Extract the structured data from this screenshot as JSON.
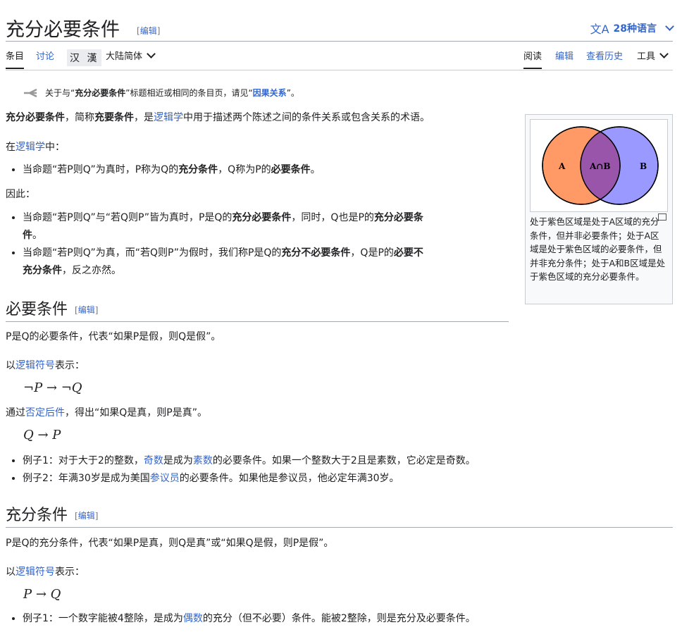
{
  "title": "充分必要条件",
  "edit_label": "编辑",
  "lang_button": {
    "icon": "文A",
    "label": "28种语言"
  },
  "tabs": {
    "article": "条目",
    "talk": "讨论",
    "variant_toggle": "汉 漢",
    "variant_select": "大陆简体",
    "read": "阅读",
    "edit": "编辑",
    "history": "查看历史",
    "tools": "工具"
  },
  "hatnote": {
    "pre": "关于与“",
    "bold": "充分必要条件",
    "mid": "”标题相近或相同的条目页，请见“",
    "link": "因果关系",
    "post": "”。"
  },
  "intro": {
    "b1": "充分必要条件",
    "t1": "，简称",
    "b2": "充要条件",
    "t2": "，是",
    "link": "逻辑学",
    "t3": "中用于描述两个陈述之间的条件关系或包含关系的术语。"
  },
  "in_logic": {
    "pre": "在",
    "link": "逻辑学",
    "post": "中："
  },
  "bullet1": {
    "t1": "当命题“若P则Q”为真时，P称为Q的",
    "b1": "充分条件",
    "t2": "，Q称为P的",
    "b2": "必要条件",
    "t3": "。"
  },
  "therefore": "因此：",
  "bullet2": {
    "t1": "当命题“若P则Q”与“若Q则P”皆为真时，P是Q的",
    "b1": "充分必要条件",
    "t2": "，同时，Q也是P的",
    "b2": "充分必要条",
    "b3": "件",
    "t3": "。"
  },
  "bullet3": {
    "t1": "当命题“若P则Q”为真，而“若Q则P”为假时，我们称P是Q的",
    "b1": "充分不必要条件",
    "t2": "，Q是P的",
    "b2": "必要不",
    "b3": "充分条件",
    "t3": "，反之亦然。"
  },
  "necessary": {
    "heading": "必要条件",
    "def": "P是Q的必要条件，代表“如果P是假，则Q是假”。",
    "sym": {
      "pre": "以",
      "link": "逻辑符号",
      "post": "表示："
    },
    "math1": "¬P → ¬Q",
    "contra": {
      "pre": "通过",
      "link": "否定后件",
      "post": "，得出“如果Q是真，则P是真”。"
    },
    "math2": "Q → P",
    "ex1": {
      "t1": "例子1：对于大于2的整数，",
      "l1": "奇数",
      "t2": "是成为",
      "l2": "素数",
      "t3": "的必要条件。如果一个整数大于2且是素数，它必定是奇数。"
    },
    "ex2": {
      "t1": "例子2：年满30岁是成为美国",
      "l1": "参议员",
      "t2": "的必要条件。如果他是参议员，他必定年满30岁。"
    }
  },
  "sufficient": {
    "heading": "充分条件",
    "def": "P是Q的充分条件，代表“如果P是真，则Q是真”或“如果Q是假，则P是假”。",
    "sym": {
      "pre": "以",
      "link": "逻辑符号",
      "post": "表示："
    },
    "math1": "P → Q",
    "ex1": {
      "t1": "例子1：一个数字能被4整除，是成为",
      "l1": "偶数",
      "t2": "的充分（但不必要）条件。能被2整除，则是充分及必要条件。"
    }
  },
  "figure": {
    "label_a": "A",
    "label_ab": "A∩B",
    "label_b": "B",
    "caption": "处于紫色区域是处于A区域的充分条件，但并非必要条件；处于A区域是处于紫色区域的必要条件，但并非充分条件；处于A和B区域是处于紫色区域的充分必要条件。",
    "colors": {
      "a": "#ff9966",
      "b": "#9999ff",
      "overlap": "#9955aa"
    }
  },
  "colors": {
    "link": "#3366cc",
    "text": "#202122"
  }
}
